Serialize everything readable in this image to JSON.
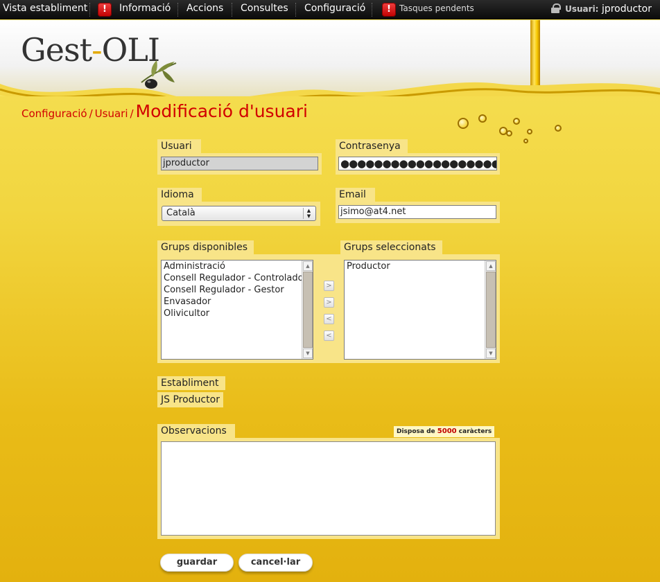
{
  "nav": {
    "items": [
      "Vista establiment",
      "Informació",
      "Accions",
      "Consultes",
      "Configuració"
    ],
    "pending_tasks": "Tasques pendents",
    "alert_glyph": "!",
    "user_label": "Usuari:",
    "username": "jproductor"
  },
  "header": {
    "logo_part1": "Gest",
    "logo_dash": "-",
    "logo_part2": "OLI"
  },
  "breadcrumb": {
    "items": [
      "Configuració",
      "Usuari"
    ],
    "separator": "/",
    "current": "Modificació d'usuari"
  },
  "form": {
    "user": {
      "label": "Usuari",
      "value": "jproductor"
    },
    "password": {
      "label": "Contrasenya",
      "masked_value": "●●●●●●●●●●●●●●●●●●●●●"
    },
    "language": {
      "label": "Idioma",
      "selected": "Català"
    },
    "email": {
      "label": "Email",
      "value": "jsimo@at4.net"
    },
    "groups_available": {
      "label": "Grups disponibles",
      "options": [
        "Administració",
        "Consell Regulador - Controlador",
        "Consell Regulador - Gestor",
        "Envasador",
        "Olivicultor"
      ]
    },
    "groups_selected": {
      "label": "Grups seleccionats",
      "options": [
        "Productor"
      ]
    },
    "move_buttons": [
      ">",
      ">",
      "<",
      "<"
    ],
    "establishment": {
      "label": "Establiment",
      "value": "JS Productor"
    },
    "observations": {
      "label": "Observacions",
      "chars_prefix": "Disposa de",
      "chars_count": "5000",
      "chars_suffix": "caràcters",
      "value": ""
    },
    "buttons": {
      "save": "guardar",
      "cancel": "cancel·lar"
    }
  },
  "colors": {
    "nav_bg": "#111111",
    "alert": "#d40000",
    "breadcrumb": "#d10000",
    "panel": "#f8e488",
    "background_top": "#f7e25a",
    "background_bottom": "#e3b10e"
  },
  "icons": {
    "alert": "alert-icon",
    "lock": "lock-icon",
    "olive": "olive-icon"
  }
}
